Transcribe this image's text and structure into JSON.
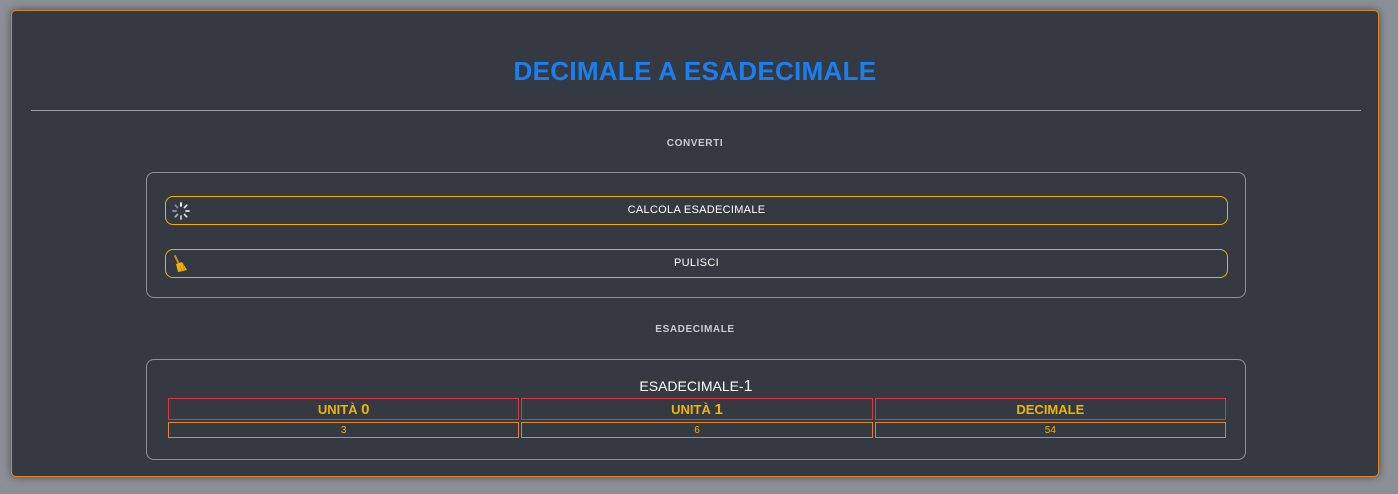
{
  "header": {
    "title": "DECIMALE A ESADECIMALE"
  },
  "convert_section": {
    "label": "CONVERTI",
    "calculate_label": "CALCOLA ESADECIMALE",
    "clear_label": "PULISCI"
  },
  "result_section": {
    "label": "ESADECIMALE",
    "table_title_prefix": "ESADECIMALE-",
    "table_title_number": "1",
    "columns": [
      {
        "prefix": "UNITÀ ",
        "number": "0"
      },
      {
        "prefix": "UNITÀ ",
        "number": "1"
      },
      {
        "prefix": "DECIMALE",
        "number": ""
      }
    ],
    "row": [
      "3",
      "6",
      "54"
    ]
  },
  "colors": {
    "accent_blue": "#1a7ff0",
    "button_border": "#f0b400",
    "header_border": "#d9383e",
    "cell_border": "#e0852a",
    "background": "#353a42"
  },
  "icons": {
    "calculate": "spinner-icon",
    "clear": "broom-icon"
  }
}
